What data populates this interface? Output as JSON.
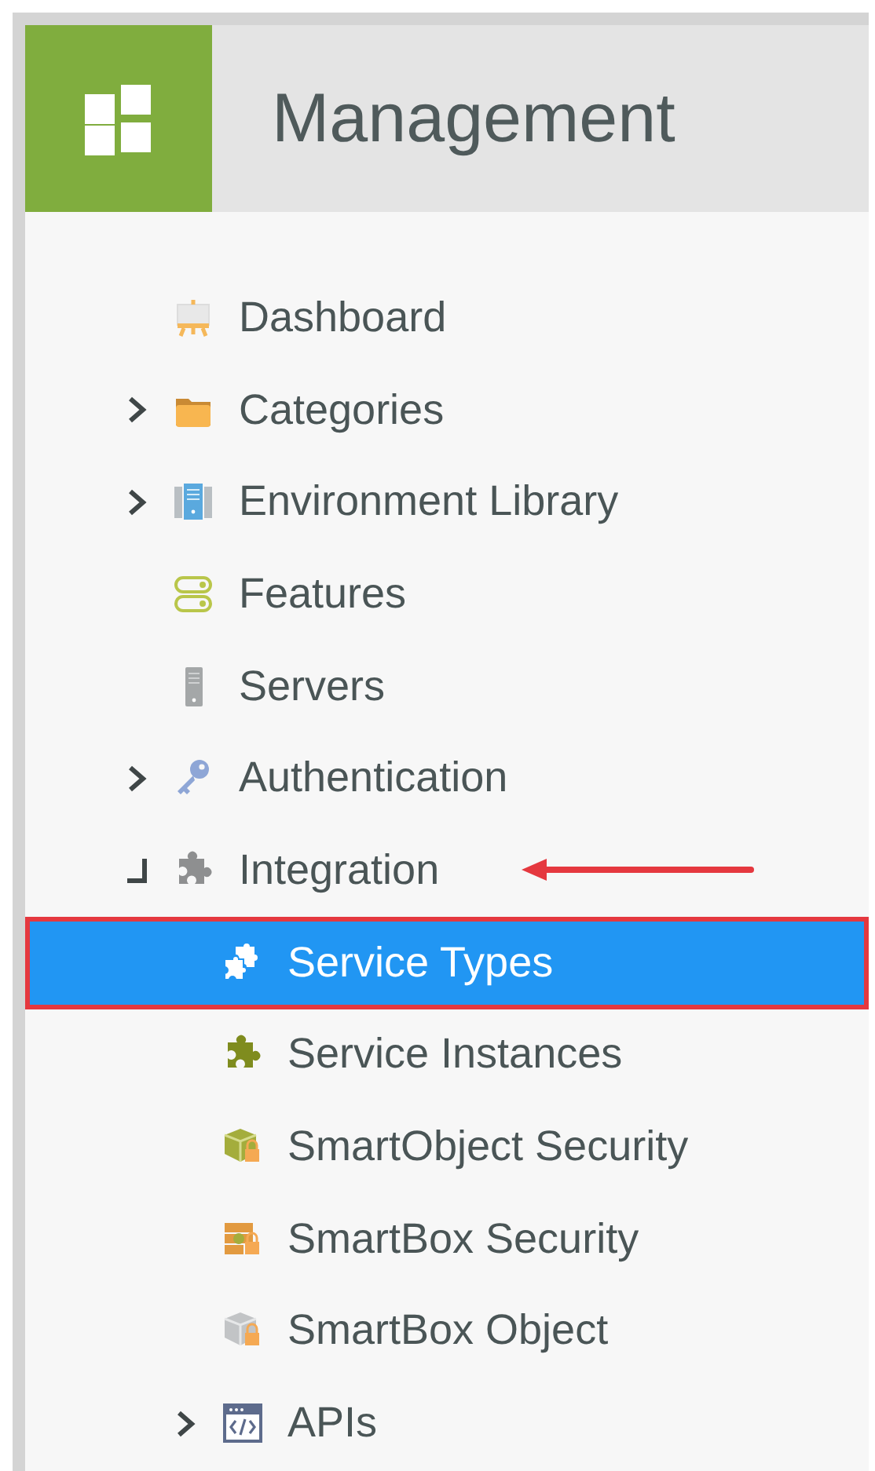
{
  "header": {
    "title": "Management"
  },
  "tree": [
    {
      "label": "Dashboard",
      "selected": false
    },
    {
      "label": "Categories",
      "expanded": false,
      "selected": false
    },
    {
      "label": "Environment Library",
      "expanded": false,
      "selected": false
    },
    {
      "label": "Features",
      "selected": false
    },
    {
      "label": "Servers",
      "selected": false
    },
    {
      "label": "Authentication",
      "expanded": false,
      "selected": false
    },
    {
      "label": "Integration",
      "expanded": true,
      "selected": false,
      "annotated": true,
      "children": [
        {
          "label": "Service Types",
          "selected": true
        },
        {
          "label": "Service Instances",
          "selected": false
        },
        {
          "label": "SmartObject Security",
          "selected": false
        },
        {
          "label": "SmartBox Security",
          "selected": false
        },
        {
          "label": "SmartBox Object",
          "selected": false
        },
        {
          "label": "APIs",
          "expanded": false,
          "selected": false
        }
      ]
    }
  ]
}
